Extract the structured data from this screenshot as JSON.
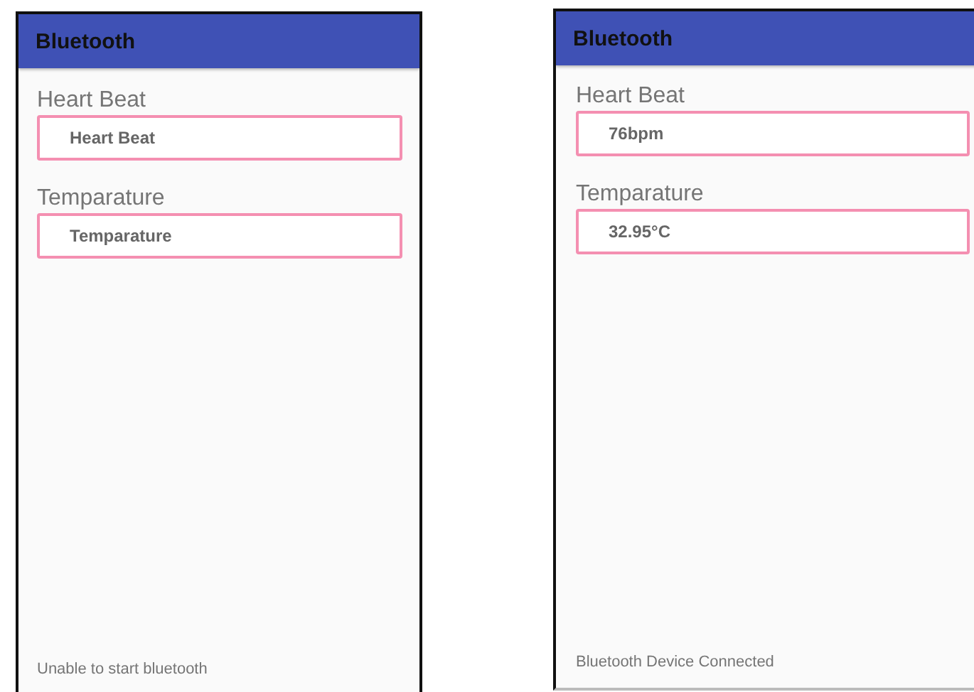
{
  "phones": [
    {
      "title": "Bluetooth",
      "fields": [
        {
          "label": "Heart Beat",
          "placeholder": "Heart Beat"
        },
        {
          "label": "Temparature",
          "placeholder": "Temparature"
        }
      ],
      "status": "Unable to start bluetooth"
    },
    {
      "title": "Bluetooth",
      "fields": [
        {
          "label": "Heart Beat",
          "value": "76bpm"
        },
        {
          "label": "Temparature",
          "value": "32.95°C"
        }
      ],
      "status": "Bluetooth Device Connected"
    }
  ]
}
